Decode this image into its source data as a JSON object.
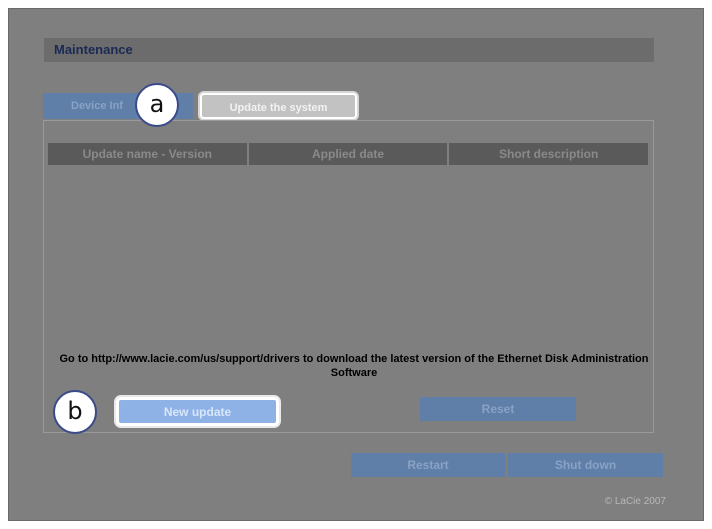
{
  "section": {
    "title": "Maintenance"
  },
  "tabs": [
    {
      "label": "Device Inf"
    },
    {
      "label": "Update the system"
    }
  ],
  "table": {
    "columns": [
      "Update name - Version",
      "Applied date",
      "Short description"
    ],
    "rows": []
  },
  "notice": "Go to http://www.lacie.com/us/support/drivers to download the latest version of the Ethernet Disk Administration Software",
  "buttons": {
    "new_update": "New update",
    "reset": "Reset",
    "restart": "Restart",
    "shutdown": "Shut down"
  },
  "callouts": {
    "a": "a",
    "b": "b"
  },
  "copyright": "© LaCie 2007",
  "colors": {
    "overlay": "#7f7f7f",
    "accent_blue": "#5f7ea8",
    "highlight_blue": "#8fb2e6",
    "title_navy": "#1a2a55"
  }
}
